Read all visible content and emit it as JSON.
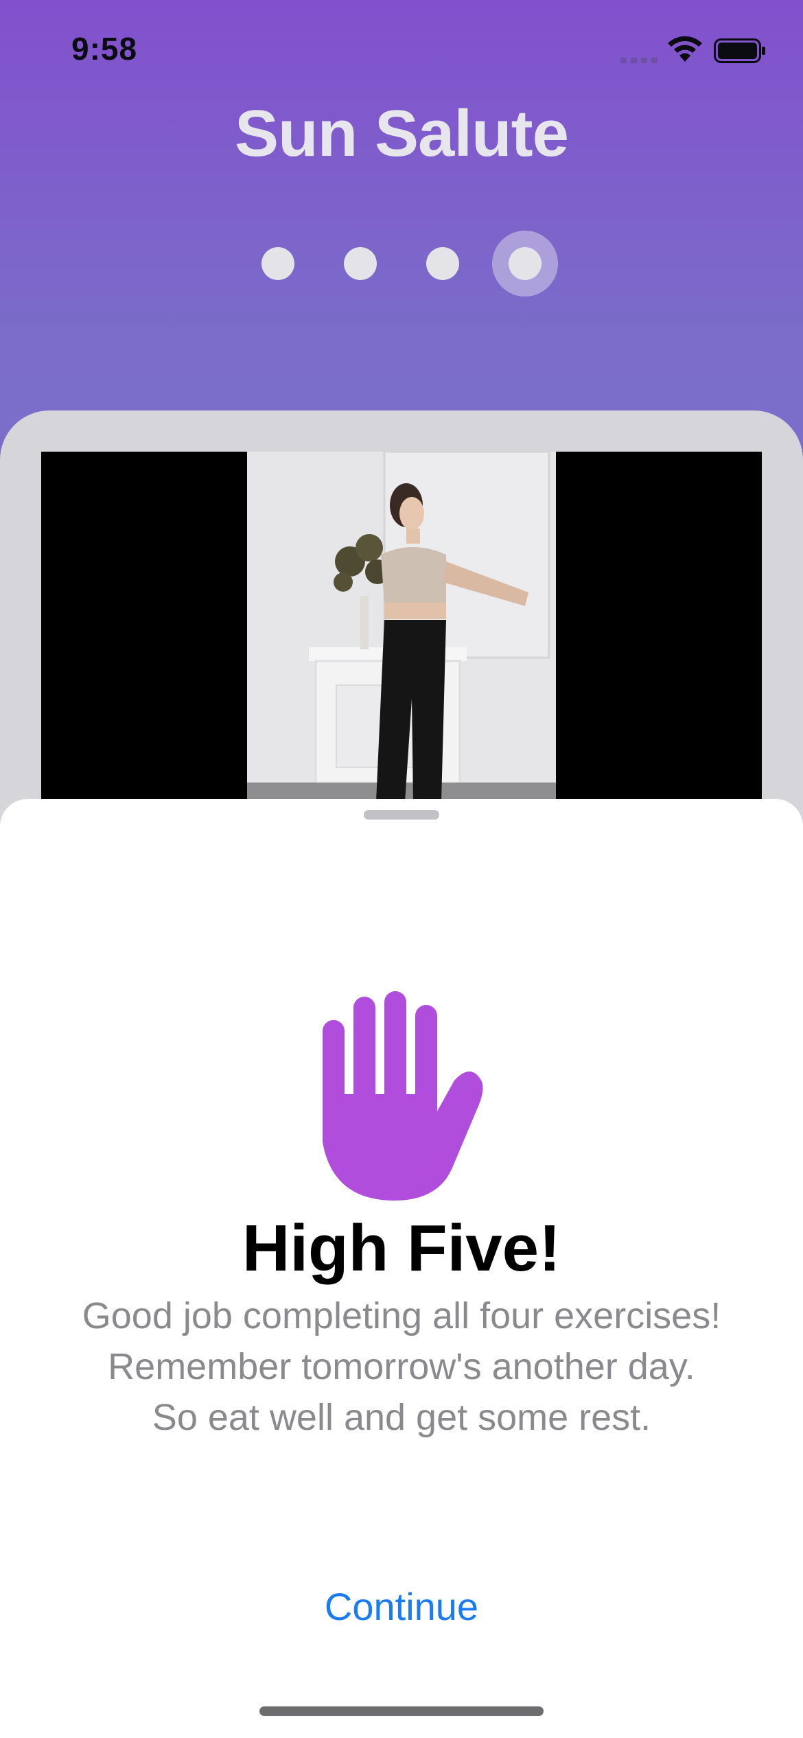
{
  "status_bar": {
    "time": "9:58"
  },
  "header": {
    "title": "Sun Salute"
  },
  "pager": {
    "total": 4,
    "current": 4
  },
  "sheet": {
    "icon": "raised-hand-icon",
    "headline": "High Five!",
    "message_lines": [
      "Good job completing all four exercises!",
      "Remember tomorrow's another day.",
      "So eat well and get some rest."
    ],
    "continue_label": "Continue"
  },
  "colors": {
    "accent_purple": "#b04ddc",
    "link_blue": "#1a7cf0",
    "gradient_top": "#8250cd",
    "gradient_bottom": "#7b72cd"
  }
}
